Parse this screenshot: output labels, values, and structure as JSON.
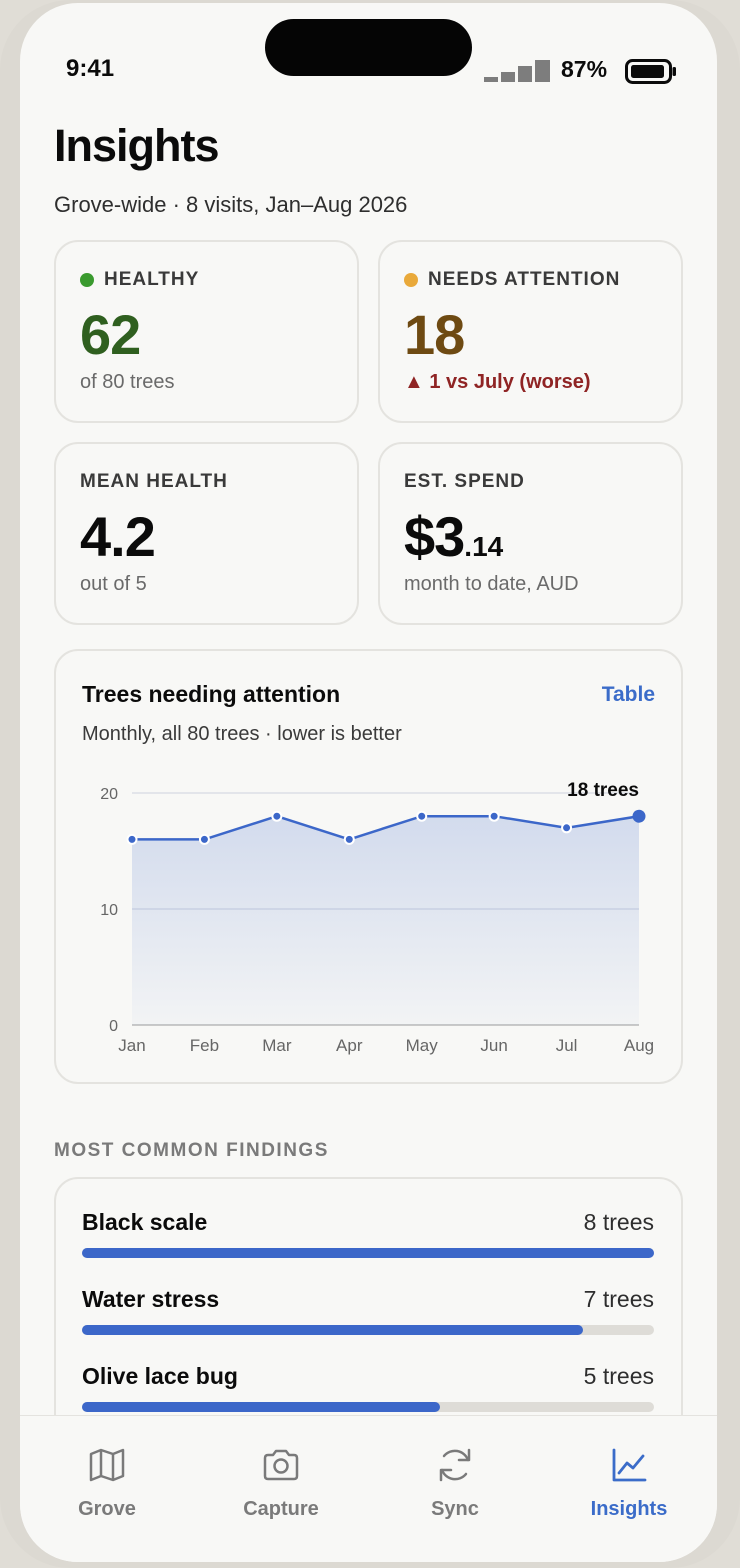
{
  "status": {
    "time": "9:41",
    "battery": "87%"
  },
  "header": {
    "title": "Insights",
    "subtitle": "Grove-wide · 8 visits, Jan–Aug 2026"
  },
  "kpis": {
    "healthy": {
      "label": "HEALTHY",
      "value": "62",
      "sub": "of 80 trees",
      "color": "#3a9a2e"
    },
    "attention": {
      "label": "NEEDS ATTENTION",
      "value": "18",
      "sub": "▲ 1 vs July (worse)",
      "color": "#e9a93a"
    },
    "mean": {
      "label": "MEAN HEALTH",
      "value": "4.2",
      "sub": "out of 5"
    },
    "spend": {
      "label": "EST. SPEND",
      "value_main": "$3",
      "value_cents": ".14",
      "sub": "month to date, AUD"
    }
  },
  "chart": {
    "title": "Trees needing attention",
    "link": "Table",
    "subtitle": "Monthly, all 80 trees · lower is better",
    "callout": "18 trees"
  },
  "chart_data": {
    "type": "area",
    "categories": [
      "Jan",
      "Feb",
      "Mar",
      "Apr",
      "May",
      "Jun",
      "Jul",
      "Aug"
    ],
    "series": [
      {
        "values": [
          16,
          16,
          18,
          16,
          18,
          18,
          17,
          18
        ]
      }
    ],
    "ylim": [
      0,
      20
    ],
    "yticks": [
      "0",
      "10",
      "20"
    ],
    "grid": true,
    "color": "#3c67c9"
  },
  "findings": {
    "heading": "MOST COMMON FINDINGS",
    "items": [
      {
        "name": "Black scale",
        "count": "8 trees",
        "fraction": 1.0
      },
      {
        "name": "Water stress",
        "count": "7 trees",
        "fraction": 0.875
      },
      {
        "name": "Olive lace bug",
        "count": "5 trees",
        "fraction": 0.625
      }
    ]
  },
  "tabs": [
    {
      "label": "Grove",
      "icon": "map-icon"
    },
    {
      "label": "Capture",
      "icon": "camera-icon"
    },
    {
      "label": "Sync",
      "icon": "sync-icon"
    },
    {
      "label": "Insights",
      "icon": "chart-icon",
      "active": true
    }
  ]
}
